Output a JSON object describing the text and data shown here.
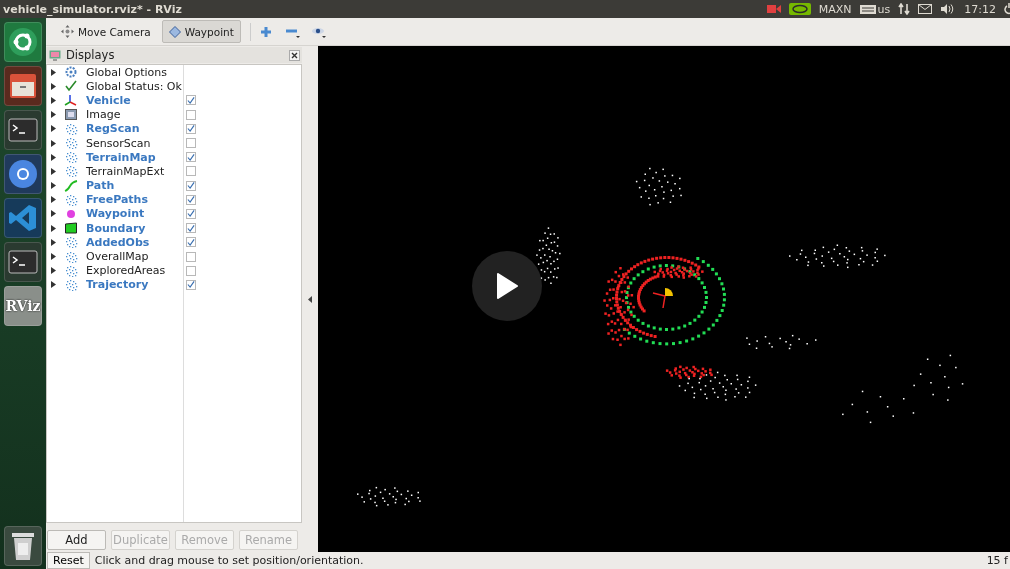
{
  "window": {
    "title": "vehicle_simulator.rviz* - RViz"
  },
  "tray": {
    "power_mode": "MAXN",
    "keyboard": "us",
    "time": "17:12"
  },
  "launcher": [
    {
      "kind": "ubuntu"
    },
    {
      "kind": "files"
    },
    {
      "kind": "terminal"
    },
    {
      "kind": "browser"
    },
    {
      "kind": "code"
    },
    {
      "kind": "terminal"
    },
    {
      "kind": "rviz",
      "label": "RViz"
    },
    {
      "kind": "trash"
    }
  ],
  "toolbar": {
    "tools": [
      {
        "kind": "move",
        "label": "Move Camera",
        "selected": false
      },
      {
        "kind": "waypoint",
        "label": "Waypoint",
        "selected": true
      }
    ]
  },
  "displays": {
    "title": "Displays",
    "items": [
      {
        "kind": "gear",
        "label": "Global Options"
      },
      {
        "kind": "status",
        "label": "Global Status: Ok"
      },
      {
        "kind": "axes",
        "label": "Vehicle",
        "checked": true
      },
      {
        "kind": "image",
        "label": "Image",
        "checked": false
      },
      {
        "kind": "cloud",
        "label": "RegScan",
        "checked": true
      },
      {
        "kind": "cloud",
        "label": "SensorScan",
        "checked": false
      },
      {
        "kind": "cloud",
        "label": "TerrainMap",
        "checked": true
      },
      {
        "kind": "cloud",
        "label": "TerrainMapExt",
        "checked": false
      },
      {
        "kind": "path",
        "label": "Path",
        "checked": true
      },
      {
        "kind": "cloud",
        "label": "FreePaths",
        "checked": true
      },
      {
        "kind": "marker",
        "label": "Waypoint",
        "checked": true
      },
      {
        "kind": "polygon",
        "label": "Boundary",
        "checked": true
      },
      {
        "kind": "cloud",
        "label": "AddedObs",
        "checked": true
      },
      {
        "kind": "cloud",
        "label": "OverallMap",
        "checked": false
      },
      {
        "kind": "cloud",
        "label": "ExploredAreas",
        "checked": false
      },
      {
        "kind": "cloud",
        "label": "Trajectory",
        "checked": true
      }
    ],
    "buttons": [
      {
        "label": "Add",
        "disabled": false
      },
      {
        "label": "Duplicate",
        "disabled": true
      },
      {
        "label": "Remove",
        "disabled": true
      },
      {
        "label": "Rename",
        "disabled": true
      }
    ]
  },
  "status_bar": {
    "reset": "Reset",
    "hint": "Click and drag mouse to set position/orientation.",
    "fps": "15 f"
  }
}
